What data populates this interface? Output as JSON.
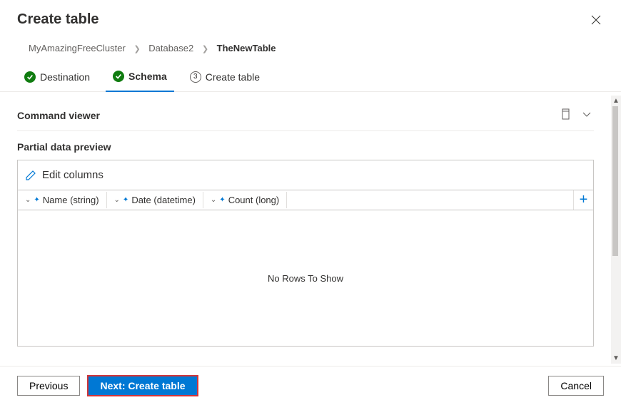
{
  "header": {
    "title": "Create table"
  },
  "breadcrumb": {
    "items": [
      "MyAmazingFreeCluster",
      "Database2",
      "TheNewTable"
    ]
  },
  "steps": [
    {
      "label": "Destination",
      "state": "done"
    },
    {
      "label": "Schema",
      "state": "active"
    },
    {
      "label": "Create table",
      "state": "pending",
      "num": "3"
    }
  ],
  "command_viewer": {
    "title": "Command viewer"
  },
  "preview": {
    "title": "Partial data preview",
    "edit_columns_label": "Edit columns",
    "columns": [
      {
        "label": "Name (string)"
      },
      {
        "label": "Date (datetime)"
      },
      {
        "label": "Count (long)"
      }
    ],
    "empty_text": "No Rows To Show"
  },
  "footer": {
    "previous": "Previous",
    "next": "Next: Create table",
    "cancel": "Cancel"
  }
}
